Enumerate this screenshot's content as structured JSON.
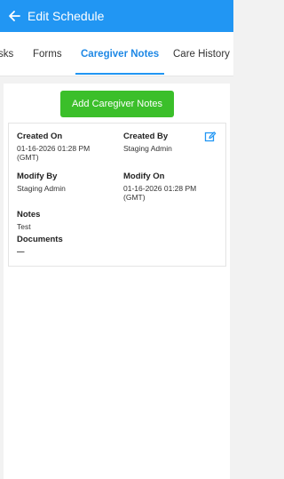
{
  "appbar": {
    "title": "Edit Schedule",
    "back_icon": "arrow-left-icon",
    "color": "#2196f3"
  },
  "tabs": [
    {
      "label": "sks"
    },
    {
      "label": "Forms"
    },
    {
      "label": "Caregiver Notes"
    },
    {
      "label": "Care History"
    }
  ],
  "active_tab": "Caregiver Notes",
  "add_button": {
    "label": "Add Caregiver Notes",
    "color": "#3bbf2a"
  },
  "note": {
    "created_on_label": "Created On",
    "created_on": "01-16-2026 01:28 PM (GMT)",
    "created_by_label": "Created By",
    "created_by": "Staging Admin",
    "modify_by_label": "Modify By",
    "modify_by": "Staging Admin",
    "modify_on_label": "Modify On",
    "modify_on": "01-16-2026 01:28 PM (GMT)",
    "notes_label": "Notes",
    "notes": "Test",
    "documents_label": "Documents",
    "documents": "—",
    "edit_icon": "edit-icon"
  }
}
